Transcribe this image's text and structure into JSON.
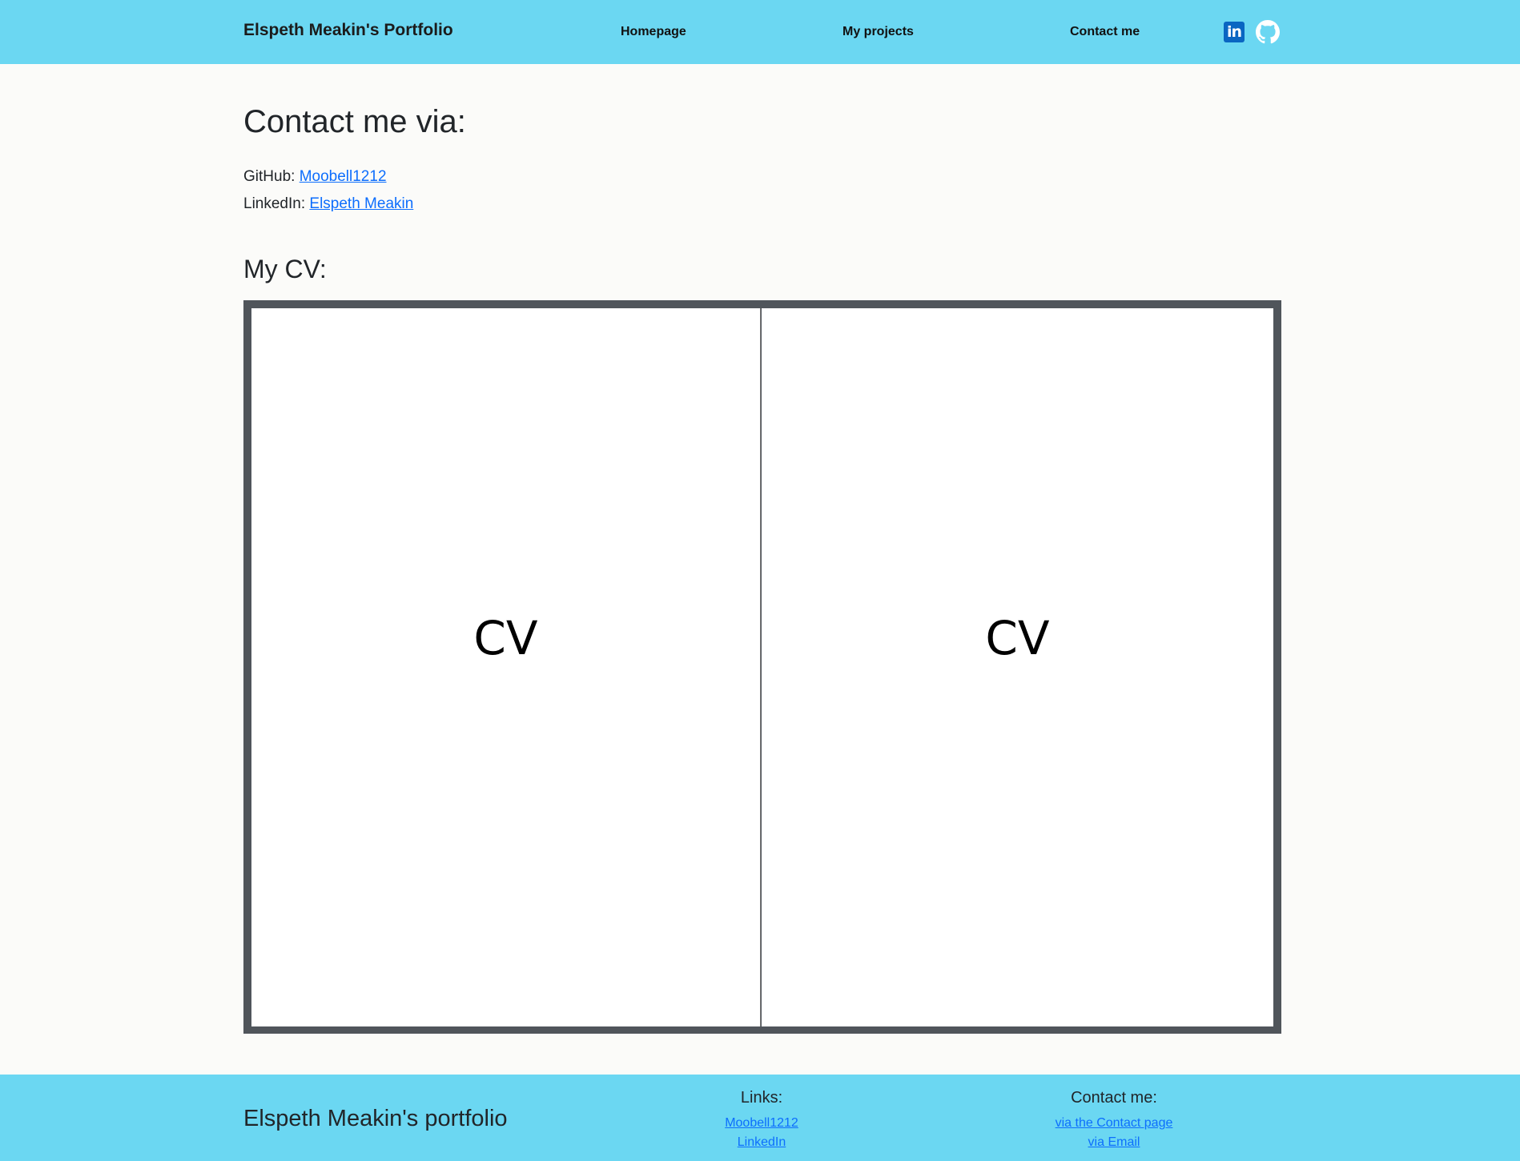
{
  "navbar": {
    "brand": "Elspeth Meakin's Portfolio",
    "links": [
      "Homepage",
      "My projects",
      "Contact me"
    ],
    "icons": [
      "linkedin-icon",
      "github-icon"
    ]
  },
  "contact": {
    "heading": "Contact me via:",
    "github_label": "GitHub:",
    "github_link": "Moobell1212",
    "linkedin_label": "LinkedIn:",
    "linkedin_link": "Elspeth Meakin"
  },
  "cv": {
    "heading": "My CV:",
    "pages": [
      "CV",
      "CV"
    ]
  },
  "footer": {
    "brand": "Elspeth Meakin's portfolio",
    "links_title": "Links:",
    "links": [
      "Moobell1212",
      "LinkedIn"
    ],
    "contact_title": "Contact me:",
    "contact_links": [
      "via the Contact page",
      "via Email"
    ]
  },
  "colors": {
    "header_bg": "#6bd7f2",
    "page_bg": "#fbfbf9",
    "link": "#0d6efd",
    "viewer_frame": "#50555b"
  }
}
